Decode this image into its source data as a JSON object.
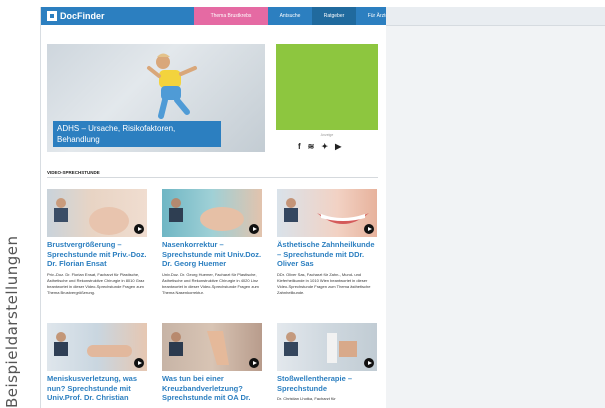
{
  "side_label": "Beispieldarstellungen",
  "header": {
    "logo_text": "DocFinder",
    "nav": [
      {
        "label": "Thema Brustkrebs"
      },
      {
        "label": "Antsuche"
      },
      {
        "label": "Ratgeber"
      },
      {
        "label": "Für Ärzte"
      }
    ]
  },
  "hero": {
    "caption": "ADHS – Ursache, Risikofaktoren, Behandlung"
  },
  "ad": {
    "label": "Anzeige"
  },
  "social": {
    "icons": [
      "facebook-icon",
      "rss-icon",
      "twitter-icon",
      "youtube-icon"
    ]
  },
  "section": {
    "title": "VIDEO-SPRECHSTUNDE"
  },
  "cards": [
    {
      "title": "Brustvergrößerung – Sprechstunde mit Priv.-Doz. Dr. Florian Ensat",
      "desc": "Priv.-Doz. Dr. Florian Ensat, Facharzt für Plastische, Ästhetische und Rekonstruktive Chirurgie in 8010 Graz beantwortet in dieser Video-Sprechstunde Fragen zum Thema Brustvergrößerung."
    },
    {
      "title": "Nasenkorrektur – Sprechstunde mit Univ.Doz. Dr. Georg Huemer",
      "desc": "Univ.Doz. Dr. Georg Huemer, Facharzt für Plastische, Ästhetische und Rekonstruktive Chirurgie in 4020 Linz beantwortet in dieser Video-Sprechstunde Fragen zum Thema Nasenkorrektur."
    },
    {
      "title": "Ästhetische Zahnheilkunde – Sprechstunde mit DDr. Oliver Sas",
      "desc": "DDr. Oliver Sas, Facharzt für Zahn-, Mund- und Kieferheilkunde in 1010 Wien beantwortet in dieser Video-Sprechstunde Fragen zum Thema ästhetische Zahnheilkunde."
    },
    {
      "title": "Meniskusverletzung, was nun? Sprechstunde mit Univ.Prof. Dr. Christian",
      "desc": ""
    },
    {
      "title": "Was tun bei einer Kreuzbandverletzung? Sprechstunde mit OA Dr.",
      "desc": ""
    },
    {
      "title": "Stoßwellentherapie – Sprechstunde",
      "desc": "Dr. Christian Lhotka, Facharzt für"
    }
  ]
}
